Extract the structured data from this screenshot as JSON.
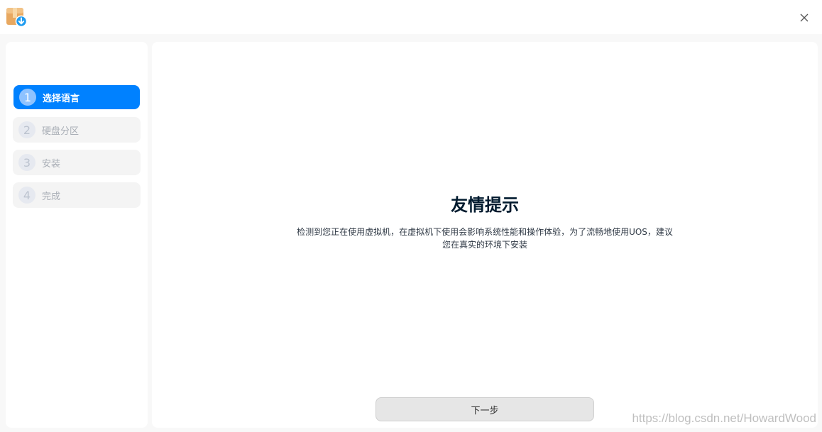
{
  "steps": [
    {
      "num": "1",
      "label": "选择语言",
      "active": true
    },
    {
      "num": "2",
      "label": "硬盘分区",
      "active": false
    },
    {
      "num": "3",
      "label": "安装",
      "active": false
    },
    {
      "num": "4",
      "label": "完成",
      "active": false
    }
  ],
  "main": {
    "title": "友情提示",
    "description_line1": "检测到您正在使用虚拟机，在虚拟机下使用会影响系统性能和操作体验，为了流畅地使用UOS，建议",
    "description_line2": "您在真实的环境下安装",
    "next_label": "下一步"
  },
  "watermark": "https://blog.csdn.net/HowardWood",
  "colors": {
    "accent": "#0081ff",
    "title_text": "#001a2e",
    "button_bg": "#e6e6e6"
  },
  "icons": {
    "app": "installer-package-icon",
    "close": "close-icon"
  }
}
